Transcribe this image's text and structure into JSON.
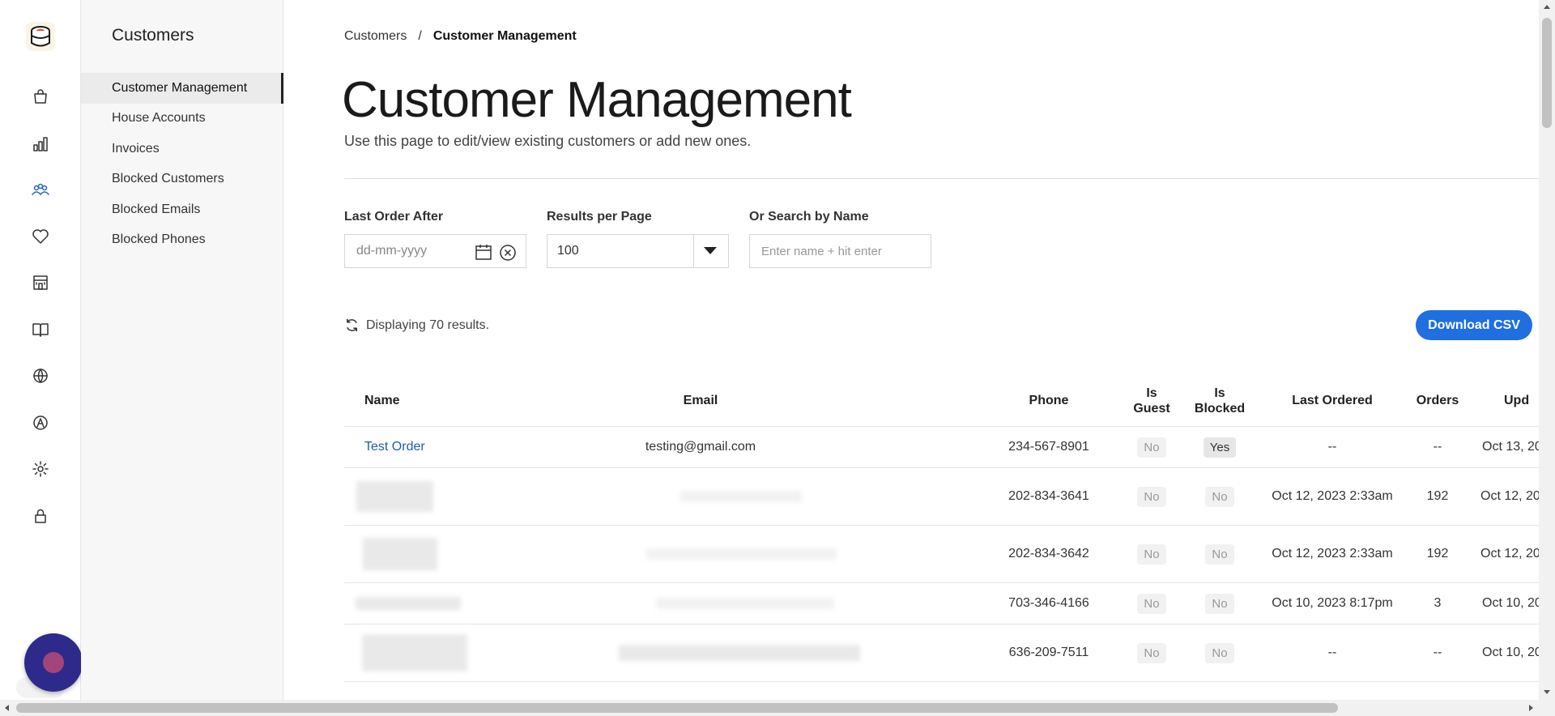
{
  "sidebar": {
    "section_title": "Customers",
    "items": [
      {
        "label": "Customer Management",
        "active": true
      },
      {
        "label": "House Accounts"
      },
      {
        "label": "Invoices"
      },
      {
        "label": "Blocked Customers"
      },
      {
        "label": "Blocked Emails"
      },
      {
        "label": "Blocked Phones"
      }
    ]
  },
  "rail_icons": [
    "logo-icon",
    "bag-icon",
    "chart-icon",
    "customers-icon",
    "heart-icon",
    "store-icon",
    "book-icon",
    "globe-icon",
    "compass-icon",
    "gear-icon",
    "lock-icon",
    "chat-widget-icon"
  ],
  "breadcrumb": {
    "parent": "Customers",
    "separator": "/",
    "current": "Customer Management"
  },
  "page": {
    "title": "Customer Management",
    "subtitle": "Use this page to edit/view existing customers or add new ones."
  },
  "filters": {
    "last_order_label": "Last Order After",
    "last_order_placeholder": "dd-mm-yyyy",
    "rpp_label": "Results per Page",
    "rpp_value": "100",
    "search_label": "Or Search by Name",
    "search_placeholder": "Enter name + hit enter"
  },
  "results_text": "Displaying 70 results.",
  "download_label": "Download CSV",
  "accent_color": "#1f6fe0",
  "table": {
    "columns": {
      "name": "Name",
      "email": "Email",
      "phone": "Phone",
      "is_guest": "Is Guest",
      "is_blocked": "Is Blocked",
      "last_ordered": "Last Ordered",
      "orders": "Orders",
      "updated": "Upd"
    },
    "rows": [
      {
        "name": "Test Order",
        "email": "testing@gmail.com",
        "phone": "234-567-8901",
        "guest": "No",
        "blocked": "Yes",
        "last": "--",
        "orders": "--",
        "updated": "Oct 13, 20"
      },
      {
        "name": "",
        "email": "",
        "phone": "202-834-3641",
        "guest": "No",
        "blocked": "No",
        "last": "Oct 12, 2023 2:33am",
        "orders": "192",
        "updated": "Oct 12, 20"
      },
      {
        "name": "",
        "email": "",
        "phone": "202-834-3642",
        "guest": "No",
        "blocked": "No",
        "last": "Oct 12, 2023 2:33am",
        "orders": "192",
        "updated": "Oct 12, 20"
      },
      {
        "name": "",
        "email": "",
        "phone": "703-346-4166",
        "guest": "No",
        "blocked": "No",
        "last": "Oct 10, 2023 8:17pm",
        "orders": "3",
        "updated": "Oct 10, 20"
      },
      {
        "name": "",
        "email": "",
        "phone": "636-209-7511",
        "guest": "No",
        "blocked": "No",
        "last": "--",
        "orders": "--",
        "updated": "Oct 10, 20"
      }
    ]
  }
}
